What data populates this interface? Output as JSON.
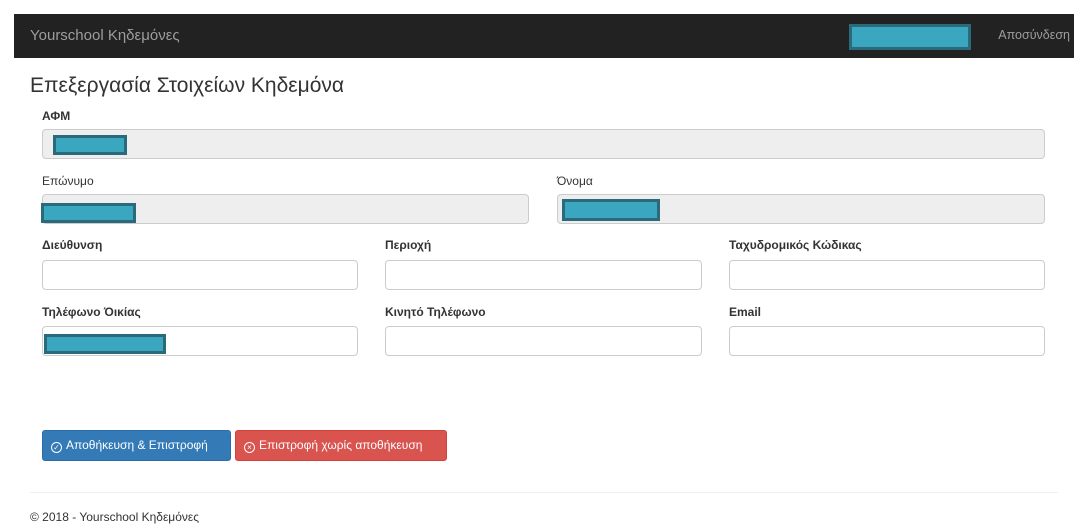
{
  "navbar": {
    "brand": "Yourschool Κηδεμόνες",
    "logout": "Αποσύνδεση"
  },
  "page": {
    "title": "Επεξεργασία Στοιχείων Κηδεμόνα"
  },
  "form": {
    "afm_label": "ΑΦΜ",
    "surname_label": "Επώνυμο",
    "name_label": "Όνομα",
    "address_label": "Διεύθυνση",
    "area_label": "Περιοχή",
    "postal_label": "Ταχυδρομικός Κώδικας",
    "home_phone_label": "Τηλέφωνο Όικίας",
    "mobile_label": "Κινητό Τηλέφωνο",
    "email_label": "Email"
  },
  "buttons": {
    "save": "Αποθήκευση & Επιστροφή",
    "cancel": "Επιστροφή χωρίς αποθήκευση"
  },
  "footer": {
    "text": "© 2018 - Yourschool Κηδεμόνες"
  }
}
